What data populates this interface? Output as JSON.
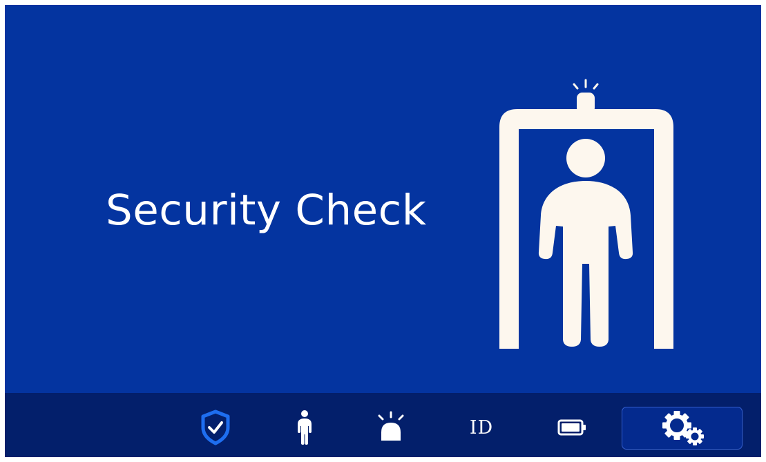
{
  "screen": {
    "title": "Security Check",
    "background_color": "#0434a0",
    "foreground_color": "#fdf7ee"
  },
  "illustration": {
    "icon": "metal-detector-gate-person-icon"
  },
  "bottom_bar": {
    "background_color": "#031f6b",
    "items": [
      {
        "name": "shield-check",
        "icon": "shield-check-icon",
        "color": "#1e6ef0"
      },
      {
        "name": "person",
        "icon": "person-icon"
      },
      {
        "name": "alarm",
        "icon": "alarm-light-icon"
      },
      {
        "name": "id",
        "label": "ID"
      },
      {
        "name": "battery",
        "icon": "battery-icon"
      },
      {
        "name": "settings",
        "icon": "gears-icon",
        "selected": true
      }
    ]
  }
}
